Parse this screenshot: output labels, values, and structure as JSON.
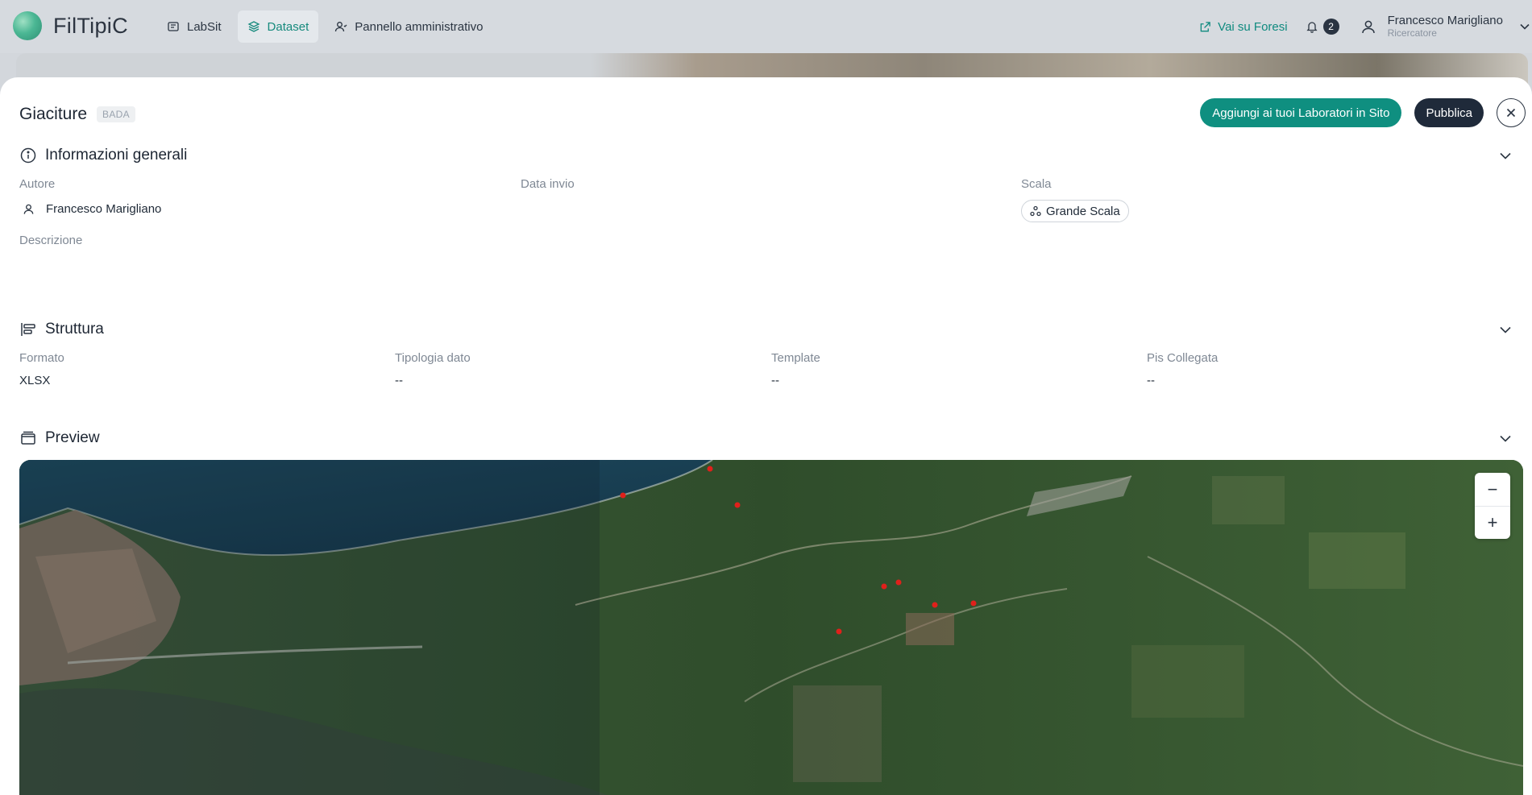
{
  "app": {
    "name": "FilTipiC"
  },
  "nav": [
    {
      "label": "LabSit",
      "icon": "lab-icon",
      "active": false
    },
    {
      "label": "Dataset",
      "icon": "layers-icon",
      "active": true
    },
    {
      "label": "Pannello amministrativo",
      "icon": "admin-icon",
      "active": false
    }
  ],
  "topbar": {
    "external_link_label": "Vai su Foresi",
    "notifications_count": "2",
    "user_name": "Francesco Marigliano",
    "user_role": "Ricercatore"
  },
  "page": {
    "title": "Giaciture",
    "tag": "BADA",
    "add_button": "Aggiungi ai tuoi Laboratori in Sito",
    "publish_button": "Pubblica"
  },
  "info": {
    "title": "Informazioni generali",
    "author_label": "Autore",
    "author_value": "Francesco Marigliano",
    "date_label": "Data invio",
    "scale_label": "Scala",
    "scale_value": "Grande Scala",
    "description_label": "Descrizione"
  },
  "structure": {
    "title": "Struttura",
    "fields": [
      {
        "label": "Formato",
        "value": "XLSX"
      },
      {
        "label": "Tipologia dato",
        "value": "--"
      },
      {
        "label": "Template",
        "value": "--"
      },
      {
        "label": "Pis Collegata",
        "value": "--"
      }
    ]
  },
  "preview": {
    "title": "Preview",
    "zoom_out": "−",
    "zoom_in": "+"
  },
  "colors": {
    "accent": "#0f8f80",
    "dark_button": "#1f2a3a",
    "marker": "#e0201b"
  }
}
